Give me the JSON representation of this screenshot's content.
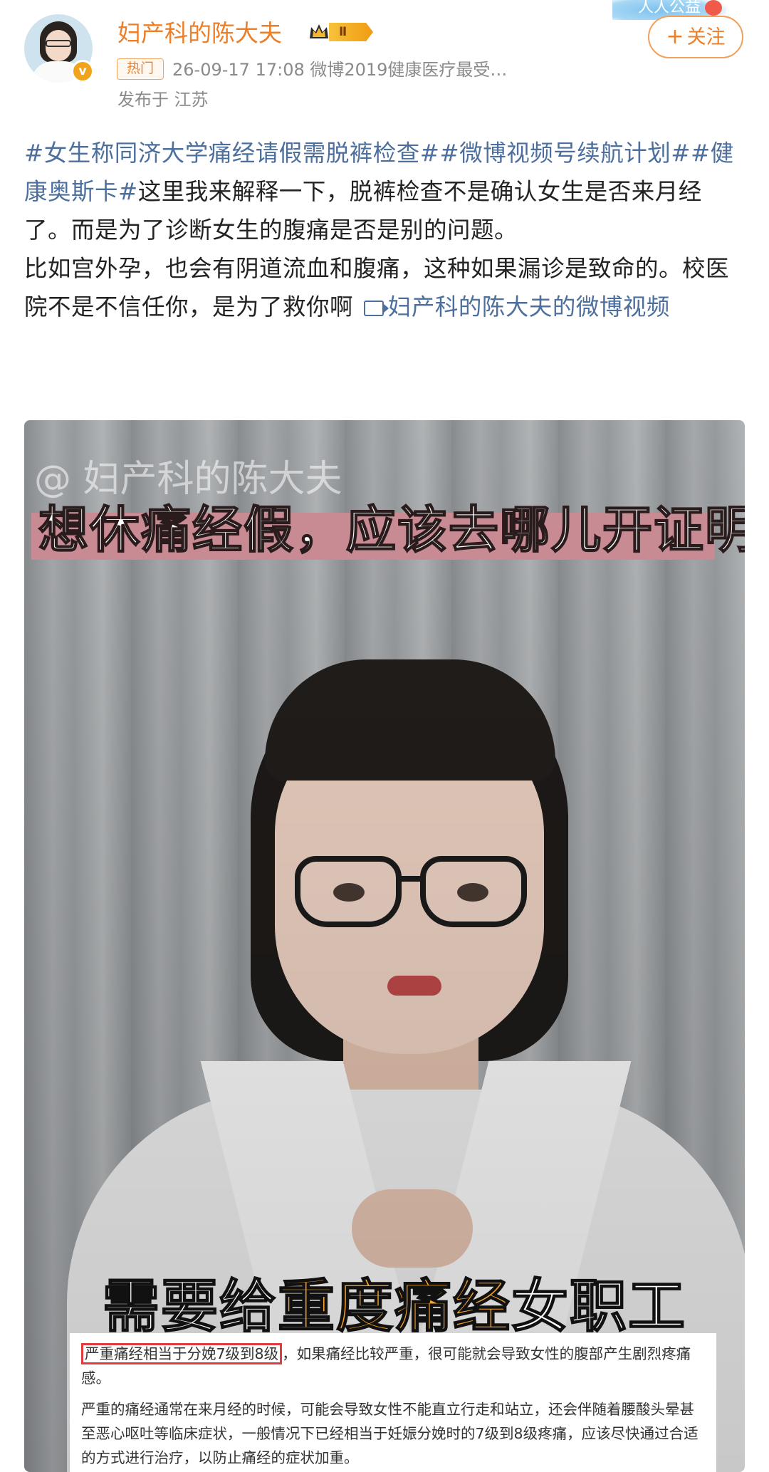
{
  "header": {
    "username": "妇产科的陈大夫",
    "level_badge": "Ⅱ",
    "follow_label": "关注",
    "follow_plus": "+",
    "gongyi_badge": "人人公益",
    "hot_tag": "热门",
    "meta": "26-09-17 17:08  微博2019健康医疗最受…",
    "location": "发布于 江苏",
    "verified_badge": "v"
  },
  "post": {
    "hashtags": [
      "#女生称同济大学痛经请假需脱裤检查#",
      "#微博视频号续航计划#",
      "#健康奥斯卡#"
    ],
    "text1": "这里我来解释一下，脱裤检查不是确认女生是否来月经了。而是为了诊断女生的腹痛是否是别的问题。",
    "text2": "比如宫外孕，也会有阴道流血和腹痛，这种如果漏诊是致命的。校医院不是不信任你，是为了救你啊",
    "video_link": "妇产科的陈大夫的微博视频"
  },
  "video": {
    "watermark": "@ 妇产科的陈大夫",
    "title": "想休痛经假，应该去哪儿开证明？",
    "subtitle_pre": "需要给",
    "subtitle_highlight": "重度痛经",
    "subtitle_post": "女职工",
    "snippet": {
      "boxed": "严重痛经相当于分娩7级到8级",
      "line1_rest": "，如果痛经比较严重，很可能就会导致女性的腹部产生剧烈疼痛感。",
      "para2": "严重的痛经通常在来月经的时候，可能会导致女性不能直立行走和站立，还会伴随着腰酸头晕甚至恶心呕吐等临床症状，一般情况下已经相当于妊娠分娩时的7级到8级疼痛，应该尽快通过合适的方式进行治疗，以防止痛经的症状加重。"
    }
  },
  "colors": {
    "username": "#ec7f2a",
    "link": "#4c6f9e",
    "title_band": "#c88b94",
    "subtitle_highlight": "#f7a227",
    "snippet_box": "#e23b3b"
  }
}
